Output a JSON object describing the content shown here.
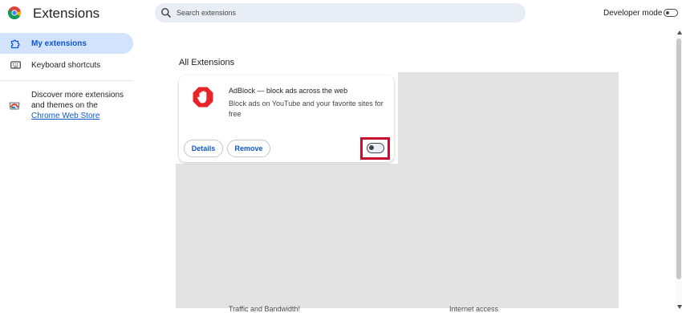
{
  "header": {
    "title": "Extensions",
    "search_placeholder": "Search extensions",
    "developer_mode_label": "Developer mode",
    "developer_mode_on": false
  },
  "sidebar": {
    "items": [
      {
        "label": "My extensions",
        "icon": "puzzle-icon",
        "active": true
      },
      {
        "label": "Keyboard shortcuts",
        "icon": "keyboard-icon",
        "active": false
      }
    ],
    "store_text": "Discover more extensions and themes on the",
    "store_link": "Chrome Web Store"
  },
  "main": {
    "section_title": "All Extensions",
    "extensions": [
      {
        "name": "AdBlock — block ads across the web",
        "description": "Block ads on YouTube and your favorite sites for free",
        "details_label": "Details",
        "remove_label": "Remove",
        "enabled": false,
        "icon": "adblock-hand-icon"
      }
    ],
    "peek_texts": [
      "Traffic and Bandwidth!",
      "Internet access"
    ]
  },
  "colors": {
    "accent": "#0b57d0",
    "active_nav_bg": "#d3e3fd",
    "highlight": "#c8102e",
    "adblock_red": "#e8232a",
    "overlay_gray": "#e3e3e3"
  }
}
